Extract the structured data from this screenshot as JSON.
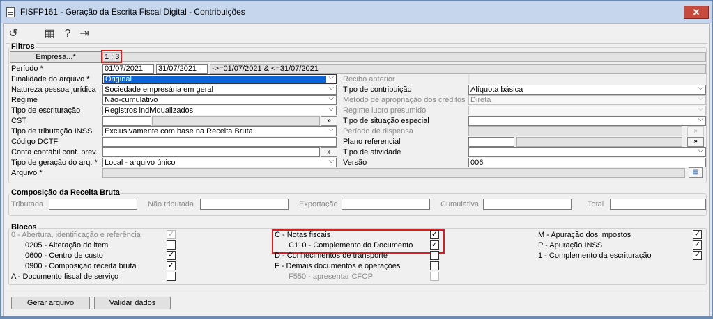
{
  "window": {
    "title": "FISFP161 - Geração da Escrita Fiscal Digital - Contribuições",
    "close_label": "✕"
  },
  "toolbar": {
    "icons": [
      "undo-icon",
      "calendar-icon",
      "help-icon",
      "exit-icon"
    ]
  },
  "filtros": {
    "title": "Filtros",
    "empresa_button": "Empresa...*",
    "empresa_value": "1 ; 3",
    "periodo_label": "Período *",
    "periodo_inicio": "01/07/2021",
    "periodo_fim": "31/07/2021",
    "periodo_expr": "->=01/07/2021 & <=31/07/2021",
    "finalidade_label": "Finalidade do arquivo *",
    "finalidade_value": "Original",
    "natureza_label": "Natureza pessoa jurídica",
    "natureza_value": "Sociedade empresária em geral",
    "regime_label": "Regime",
    "regime_value": "Não-cumulativo",
    "tipo_escrituracao_label": "Tipo de escrituração",
    "tipo_escrituracao_value": "Registros individualizados",
    "cst_label": "CST",
    "cst_value": "",
    "tipo_tributacao_label": "Tipo de tributação INSS",
    "tipo_tributacao_value": "Exclusivamente com base na Receita Bruta",
    "codigo_dctf_label": "Código DCTF",
    "codigo_dctf_value": "",
    "conta_contabil_label": "Conta contábil cont. prev.",
    "conta_contabil_value": "",
    "tipo_geracao_label": "Tipo de geração do arq. *",
    "tipo_geracao_value": "Local - arquivo único",
    "arquivo_label": "Arquivo *",
    "arquivo_value": "",
    "recibo_label": "Recibo anterior",
    "recibo_value": "",
    "tipo_contribuicao_label": "Tipo de contribuição",
    "tipo_contribuicao_value": "Alíquota básica",
    "metodo_label": "Método de apropriação dos créditos",
    "metodo_value": "Direta",
    "regime_lucro_label": "Regime lucro presumido",
    "regime_lucro_value": "",
    "tipo_situacao_label": "Tipo de situação especial",
    "tipo_situacao_value": "",
    "periodo_dispensa_label": "Período de dispensa",
    "plano_referencial_label": "Plano referencial",
    "tipo_atividade_label": "Tipo de atividade",
    "tipo_atividade_value": "",
    "versao_label": "Versão",
    "versao_value": "006",
    "lookup_label": "»"
  },
  "composicao": {
    "title": "Composição da Receita Bruta",
    "tributada_label": "Tributada",
    "nao_tributada_label": "Não tributada",
    "exportacao_label": "Exportação",
    "cumulativa_label": "Cumulativa",
    "total_label": "Total"
  },
  "blocos": {
    "title": "Blocos",
    "items_left": [
      {
        "label": "0 - Abertura, identificação e referência",
        "checked": true,
        "disabled": true
      },
      {
        "label": "0205 - Alteração do item",
        "checked": false,
        "disabled": false
      },
      {
        "label": "0600 - Centro de custo",
        "checked": true,
        "disabled": false
      },
      {
        "label": "0900 - Composição receita bruta",
        "checked": true,
        "disabled": false
      },
      {
        "label": "A - Documento fiscal de serviço",
        "checked": false,
        "disabled": false
      }
    ],
    "items_mid": [
      {
        "label": "C - Notas fiscais",
        "checked": true,
        "disabled": false
      },
      {
        "label": "C110 - Complemento do Documento",
        "checked": true,
        "disabled": false
      },
      {
        "label": "D - Conhecimentos de transporte",
        "checked": false,
        "disabled": false
      },
      {
        "label": "F - Demais documentos e operações",
        "checked": false,
        "disabled": false
      },
      {
        "label": "F550 - apresentar CFOP",
        "checked": false,
        "disabled": true
      }
    ],
    "items_right": [
      {
        "label": "M - Apuração dos impostos",
        "checked": true,
        "disabled": false
      },
      {
        "label": "P - Apuração INSS",
        "checked": true,
        "disabled": false
      },
      {
        "label": "1 - Complemento da escrituração",
        "checked": true,
        "disabled": false
      }
    ]
  },
  "actions": {
    "gerar": "Gerar arquivo",
    "validar": "Validar dados"
  }
}
